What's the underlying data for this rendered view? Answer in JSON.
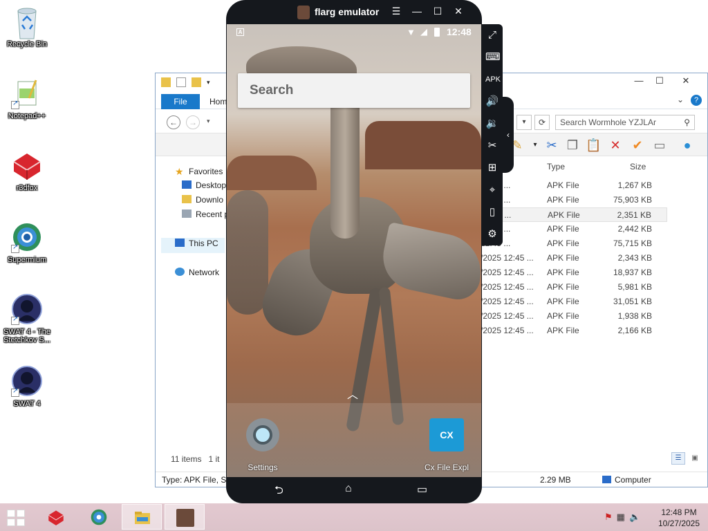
{
  "desktop": {
    "icons": [
      {
        "label": "Recycle Bin",
        "icon": "recycle-bin-icon"
      },
      {
        "label": "Notepad++",
        "icon": "notepad-plus-icon"
      },
      {
        "label": "r3dfox",
        "icon": "r3dfox-icon"
      },
      {
        "label": "Supermium",
        "icon": "supermium-icon"
      },
      {
        "label": "SWAT 4 - The Stetchkov S...",
        "icon": "swat4-expansion-icon"
      },
      {
        "label": "SWAT 4",
        "icon": "swat4-icon"
      }
    ]
  },
  "explorer": {
    "ribbon": {
      "file_tab": "File",
      "home_tab": "Hom"
    },
    "search_placeholder": "Search Wormhole YZJLAr",
    "nav": {
      "favorites": "Favorites",
      "desktop": "Desktop",
      "downloads": "Downlo",
      "recent": "Recent p",
      "this_pc": "This PC",
      "network": "Network"
    },
    "columns": {
      "date": "",
      "type": "Type",
      "size": "Size"
    },
    "rows": [
      {
        "date": "12:45 ...",
        "type": "APK File",
        "size": "1,267 KB"
      },
      {
        "date": "12:45 ...",
        "type": "APK File",
        "size": "75,903 KB"
      },
      {
        "date": "12:45 ...",
        "type": "APK File",
        "size": "2,351 KB"
      },
      {
        "date": "12:45 ...",
        "type": "APK File",
        "size": "2,442 KB"
      },
      {
        "date": "12:45 ...",
        "type": "APK File",
        "size": "75,715 KB"
      },
      {
        "date": "/2025 12:45 ...",
        "type": "APK File",
        "size": "2,343 KB"
      },
      {
        "date": "/2025 12:45 ...",
        "type": "APK File",
        "size": "18,937 KB"
      },
      {
        "date": "/2025 12:45 ...",
        "type": "APK File",
        "size": "5,981 KB"
      },
      {
        "date": "/2025 12:45 ...",
        "type": "APK File",
        "size": "31,051 KB"
      },
      {
        "date": "/2025 12:45 ...",
        "type": "APK File",
        "size": "1,938 KB"
      },
      {
        "date": "/2025 12:45 ...",
        "type": "APK File",
        "size": "2,166 KB"
      }
    ],
    "items_count": "11 items",
    "selected_count": "1 it",
    "status": {
      "type_info": "Type: APK File, Siz",
      "size": "2.29 MB",
      "location": "Computer"
    }
  },
  "emulator": {
    "title": "flarg emulator",
    "status_time": "12:48",
    "status_notif": "A",
    "search_label": "Search",
    "apps": [
      {
        "label": "Settings",
        "icon": "settings-gear-icon"
      },
      {
        "label": "Cx File Expl",
        "icon": "cx-file-explorer-icon",
        "glyph": "CX"
      }
    ]
  },
  "taskbar": {
    "clock_time": "12:48 PM",
    "clock_date": "10/27/2025"
  }
}
